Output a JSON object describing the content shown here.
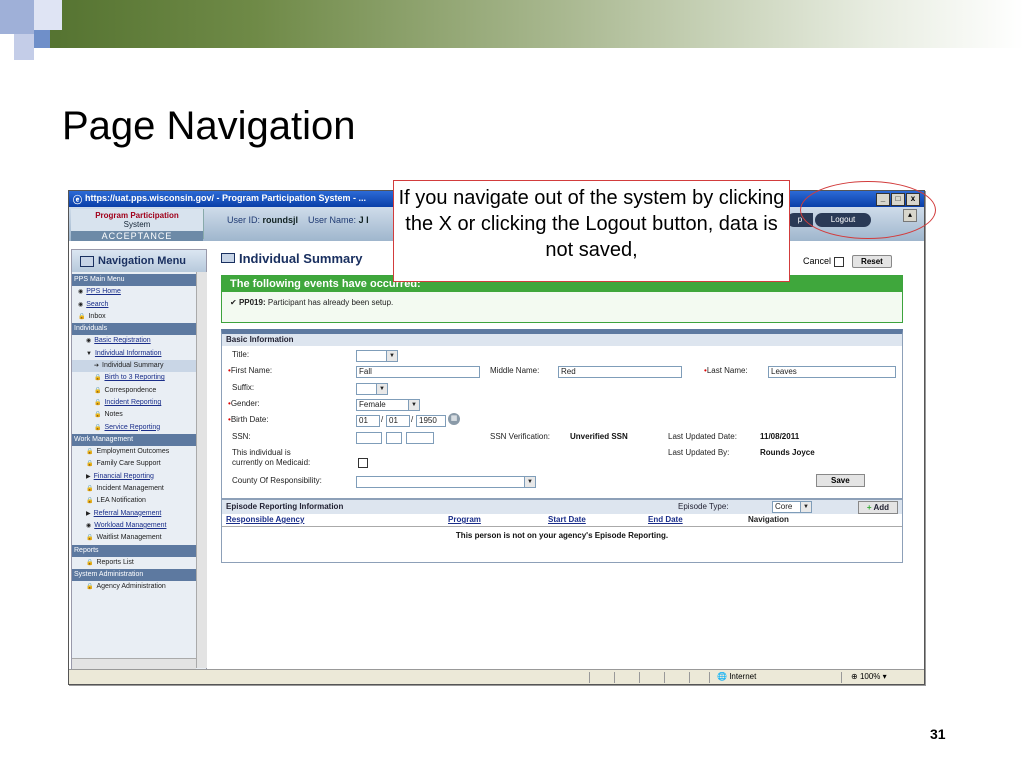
{
  "slide": {
    "title": "Page Navigation",
    "number": "31",
    "callout": "If you navigate out of the system by clicking the X or clicking the Logout button, data is not saved,"
  },
  "browser": {
    "title": "https://uat.pps.wisconsin.gov/ - Program Participation System - ...",
    "status_zone": "Internet",
    "zoom": "100%"
  },
  "app": {
    "logo_line1": "Program Participation",
    "logo_line2": "System",
    "environment": "ACCEPTANCE",
    "user_id_label": "User ID:",
    "user_id": "roundsjl",
    "user_name_label": "User Name:",
    "user_name": "J I",
    "help_label": "p",
    "logout_label": "Logout"
  },
  "nav": {
    "title": "Navigation Menu",
    "items": [
      {
        "label": "PPS Main Menu",
        "type": "sec"
      },
      {
        "label": "PPS Home",
        "type": "l1",
        "link": true,
        "icon": "◉"
      },
      {
        "label": "Search",
        "type": "l1",
        "link": true,
        "icon": "◉"
      },
      {
        "label": "Inbox",
        "type": "l1",
        "link": false,
        "icon": "🔒"
      },
      {
        "label": "Individuals",
        "type": "sec"
      },
      {
        "label": "Basic Registration",
        "type": "l2",
        "link": true,
        "icon": "◉"
      },
      {
        "label": "Individual Information",
        "type": "l2",
        "link": true,
        "icon": "▼"
      },
      {
        "label": "Individual Summary",
        "type": "l3",
        "link": false,
        "icon": "➔",
        "current": true
      },
      {
        "label": "Birth to 3 Reporting",
        "type": "l3",
        "link": true,
        "icon": "🔒"
      },
      {
        "label": "Correspondence",
        "type": "l3",
        "link": false,
        "icon": "🔒"
      },
      {
        "label": "Incident Reporting",
        "type": "l3",
        "link": true,
        "icon": "🔒"
      },
      {
        "label": "Notes",
        "type": "l3",
        "link": false,
        "icon": "🔒"
      },
      {
        "label": "Service Reporting",
        "type": "l3",
        "link": true,
        "icon": "🔒"
      },
      {
        "label": "Work Management",
        "type": "sec"
      },
      {
        "label": "Employment Outcomes",
        "type": "l2",
        "link": false,
        "icon": "🔒"
      },
      {
        "label": "Family Care Support",
        "type": "l2",
        "link": false,
        "icon": "🔒"
      },
      {
        "label": "Financial Reporting",
        "type": "l2",
        "link": true,
        "icon": "▶"
      },
      {
        "label": "Incident Management",
        "type": "l2",
        "link": false,
        "icon": "🔒"
      },
      {
        "label": "LEA Notification",
        "type": "l2",
        "link": false,
        "icon": "🔒"
      },
      {
        "label": "Referral Management",
        "type": "l2",
        "link": true,
        "icon": "▶"
      },
      {
        "label": "Workload Management",
        "type": "l2",
        "link": true,
        "icon": "◉"
      },
      {
        "label": "Waitlist Management",
        "type": "l2",
        "link": false,
        "icon": "🔒"
      },
      {
        "label": "Reports",
        "type": "sec"
      },
      {
        "label": "Reports List",
        "type": "l2",
        "link": false,
        "icon": "🔒"
      },
      {
        "label": "System Administration",
        "type": "sec"
      },
      {
        "label": "Agency Administration",
        "type": "l2",
        "link": false,
        "icon": "🔒"
      }
    ]
  },
  "main": {
    "page_title": "Individual Summary",
    "cancel_label": "Cancel",
    "reset_label": "Reset",
    "events_header": "The following events have occurred:",
    "event_code": "PP019:",
    "event_text": "Participant has already been setup.",
    "basic_header": "Basic Information",
    "title_label": "Title:",
    "first_name_label": "First Name:",
    "first_name": "Fall",
    "middle_name_label": "Middle Name:",
    "middle_name": "Red",
    "last_name_label": "Last Name:",
    "last_name": "Leaves",
    "suffix_label": "Suffix:",
    "gender_label": "Gender:",
    "gender": "Female",
    "birth_label": "Birth Date:",
    "birth_mm": "01",
    "birth_dd": "01",
    "birth_yyyy": "1950",
    "ssn_label": "SSN:",
    "ssn_verification_label": "SSN Verification:",
    "ssn_verification": "Unverified SSN",
    "last_updated_date_label": "Last Updated Date:",
    "last_updated_date": "11/08/2011",
    "medicaid_label_1": "This individual is",
    "medicaid_label_2": "currently on Medicaid:",
    "last_updated_by_label": "Last Updated By:",
    "last_updated_by": "Rounds Joyce",
    "county_label": "County Of Responsibility:",
    "save_label": "Save",
    "episode_header": "Episode Reporting Information",
    "episode_type_label": "Episode Type:",
    "episode_type": "Core",
    "add_label": "Add",
    "col_agency": "Responsible Agency",
    "col_program": "Program",
    "col_start": "Start Date",
    "col_end": "End Date",
    "col_nav": "Navigation",
    "episode_message": "This person is not on your agency's Episode Reporting."
  },
  "colors": {
    "accent": "#d23c3c",
    "nav_section": "#5d79a0",
    "success": "#3fa73c"
  }
}
